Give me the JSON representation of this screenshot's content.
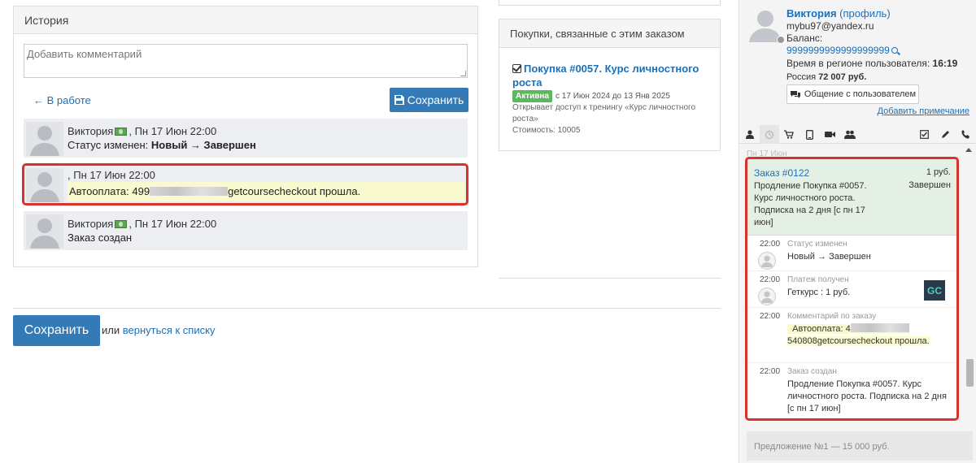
{
  "history": {
    "title": "История",
    "comment_placeholder": "Добавить комментарий",
    "back_link": "← В работе",
    "save_button": "Сохранить",
    "entries": [
      {
        "author": "Виктория",
        "date": ", Пн 17 Июн 22:00",
        "status_prefix": "Статус изменен: ",
        "status_change": "Новый → Завершен"
      },
      {
        "date": ", Пн 17 Июн 22:00",
        "text_prefix": "Автооплата: 499",
        "text_suffix": "getcoursecheckout прошла."
      },
      {
        "author": "Виктория",
        "date": ", Пн 17 Июн 22:00",
        "text": "Заказ создан"
      }
    ]
  },
  "bottom": {
    "save_button": "Сохранить",
    "or_text": "или ",
    "back_to_list": "вернуться к списку"
  },
  "purchases": {
    "title": "Покупки, связанные с этим заказом",
    "item": {
      "name": "Покупка #0057. Курс личностного роста",
      "status_badge": "Активна",
      "period": "с 17 Июн 2024 до 13 Янв 2025",
      "description": "Открывает доступ к тренингу «Курс личностного роста»",
      "cost": "Стоимость: 10005"
    }
  },
  "sidebar": {
    "user_name": "Виктория",
    "profile_link": "(профиль)",
    "email": "mybu97@yandex.ru",
    "balance_label": "Баланс:",
    "balance_value": "9999999999999999999",
    "region_time_label": "Время в регионе пользователя: ",
    "region_time_value": "16:19",
    "country": "Россия ",
    "country_amount": "72 007 руб.",
    "chat_button": "Общение с пользователем",
    "add_note": "Добавить примечание",
    "tabs": [
      "user-icon",
      "history-icon",
      "cart-icon",
      "tablet-icon",
      "video-icon",
      "group-icon",
      "checklist-icon",
      "pencil-icon",
      "phone-icon"
    ],
    "date_label": "Пн 17 Июн",
    "order": {
      "link": "Заказ #0122",
      "price": "1 руб.",
      "description": "Продление Покупка #0057. Курс личностного роста. Подписка на 2 дня [с пн 17 июн]",
      "state": "Завершен"
    },
    "events": [
      {
        "time": "22:00",
        "kind": "Статус изменен",
        "value": "Новый → Завершен"
      },
      {
        "time": "22:00",
        "kind": "Платеж получен",
        "value": "Геткурс : 1 руб."
      },
      {
        "time": "22:00",
        "kind": "Комментарий по заказу",
        "value_prefix": "Автооплата: 4",
        "value_suffix": "540808getcoursecheckout прошла."
      },
      {
        "time": "22:00",
        "kind": "Заказ создан",
        "value": "Продление Покупка #0057. Курс личностного роста. Подписка на 2 дня [с пн 17 июн]"
      }
    ],
    "gc_logo": "GC",
    "offer": "Предложение №1 — 15 000 руб."
  },
  "colors": {
    "accent": "#337ab7",
    "link": "#1d70b7",
    "highlight_border": "#d9322c",
    "active_badge": "#5cb85c",
    "order_bg": "#e3f0e3"
  }
}
